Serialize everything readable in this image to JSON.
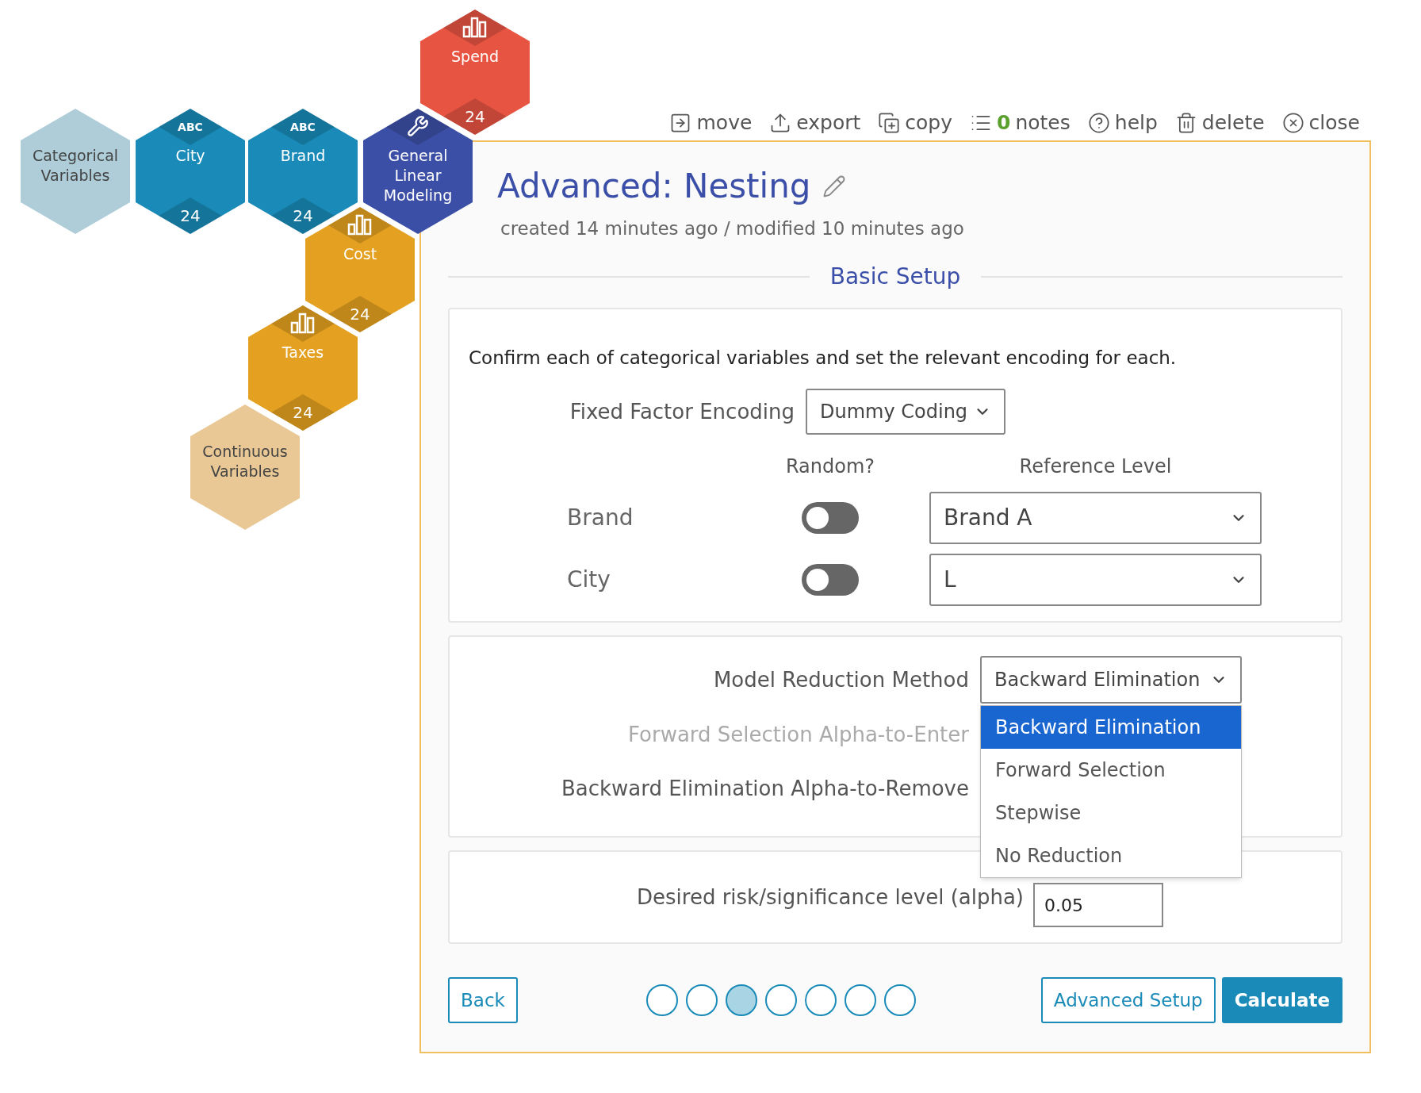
{
  "hexagons": [
    {
      "label": "Categorical Variables",
      "kind": "group",
      "color": "#aecdd8"
    },
    {
      "label": "City",
      "kind": "categorical",
      "badge": "ABC",
      "count": "24",
      "color": "#1a8bb8"
    },
    {
      "label": "Brand",
      "kind": "categorical",
      "badge": "ABC",
      "count": "24",
      "color": "#1a8bb8"
    },
    {
      "label": "General Linear Modeling",
      "kind": "model",
      "color": "#3c4fa6"
    },
    {
      "label": "Spend",
      "kind": "continuous",
      "count": "24",
      "color": "#e85442"
    },
    {
      "label": "Cost",
      "kind": "continuous",
      "count": "24",
      "color": "#e4a020"
    },
    {
      "label": "Taxes",
      "kind": "continuous",
      "count": "24",
      "color": "#e4a020"
    },
    {
      "label": "Continuous Variables",
      "kind": "group",
      "color": "#e9c896"
    }
  ],
  "toolbar": [
    {
      "label": "move"
    },
    {
      "label": "export"
    },
    {
      "label": "copy"
    },
    {
      "label": "notes",
      "count": "0"
    },
    {
      "label": "help"
    },
    {
      "label": "delete"
    },
    {
      "label": "close"
    }
  ],
  "title": "Advanced: Nesting",
  "subtitle": "created 14 minutes ago / modified 10 minutes ago",
  "section_title": "Basic Setup",
  "encoding": {
    "instruction": "Confirm each of categorical variables and set the relevant encoding for each.",
    "fixed_factor": {
      "label": "Fixed Factor Encoding",
      "value": "Dummy Coding"
    },
    "columns": [
      "Random?",
      "Reference Level"
    ],
    "rows": [
      {
        "name": "Brand",
        "random": false,
        "reference": "Brand A"
      },
      {
        "name": "City",
        "random": false,
        "reference": "L"
      }
    ]
  },
  "reduction": {
    "label": "Model Reduction Method",
    "value": "Backward Elimination",
    "expanded": true,
    "options": [
      {
        "label": "Backward Elimination",
        "selected": true
      },
      {
        "label": "Forward Selection",
        "selected": false
      },
      {
        "label": "Stepwise",
        "selected": false
      },
      {
        "label": "No Reduction",
        "selected": false
      }
    ],
    "alphas": [
      {
        "label": "Forward Selection Alpha-to-Enter",
        "disabled": true
      },
      {
        "label": "Backward Elimination Alpha-to-Remove",
        "disabled": false
      }
    ]
  },
  "alpha": {
    "label": "Desired risk/significance level (alpha)",
    "value": "0.05"
  },
  "footer": {
    "back": "Back",
    "steps": [
      {
        "selected": false
      },
      {
        "selected": false
      },
      {
        "selected": true
      },
      {
        "selected": false
      },
      {
        "selected": false
      },
      {
        "selected": false
      },
      {
        "selected": false
      }
    ],
    "buttons": [
      {
        "label": "Advanced Setup",
        "kind": "secondary"
      },
      {
        "label": "Calculate",
        "kind": "primary"
      }
    ]
  }
}
